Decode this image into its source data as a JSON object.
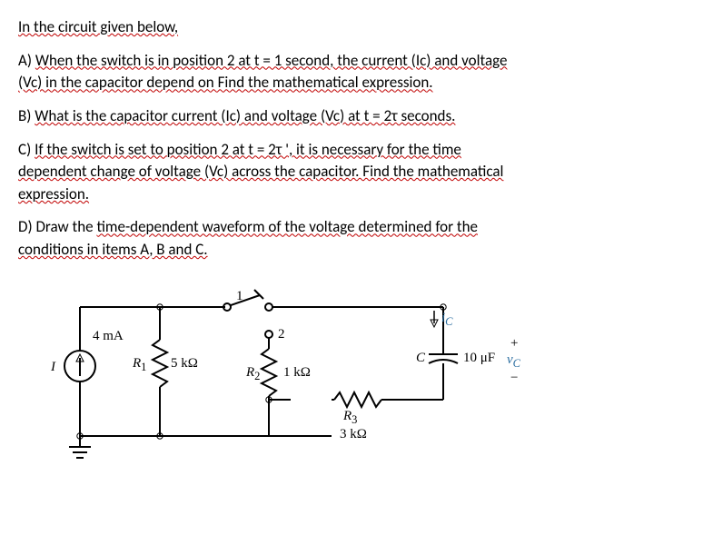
{
  "question_intro": {
    "t1": "In the circuit given below,"
  },
  "part_a": {
    "t1": "A) ",
    "t2": "When the switch is in position 2 at t = 1 second, the current (Ic) and voltage",
    "t3": "(Vc) in the capacitor depend on Find the mathematical expression."
  },
  "part_b": {
    "t1": "B) ",
    "t2": "What is the capacitor current (Ic) and voltage (Vc) at t = 2τ seconds."
  },
  "part_c": {
    "t1": "C) ",
    "t2": "If the switch is set to position 2 at t = 2τ ', it is necessary for the time",
    "t3": "dependent change of voltage (Vc) across the capacitor. Find the mathematical",
    "t4": "expression."
  },
  "part_d": {
    "t1": "D) Draw the ",
    "t2": "time-dependent waveform of the voltage determined for the",
    "t3": "conditions in items A, B and C."
  },
  "circuit": {
    "source_value": "4 mA",
    "source_symbol": "I",
    "R1_name": "R",
    "R1_sub": "1",
    "R1_value": "5 kΩ",
    "R2_name": "R",
    "R2_sub": "2",
    "R2_value": "1 kΩ",
    "R3_name": "R",
    "R3_sub": "3",
    "R3_value": "3 kΩ",
    "C_name": "C",
    "C_value": "10 μF",
    "sw_pos1": "1",
    "sw_pos2": "2",
    "ic_label": "i",
    "ic_sub": "C",
    "vc_symbol": "v",
    "vc_sub": "C",
    "plus": "+",
    "minus": "−"
  }
}
